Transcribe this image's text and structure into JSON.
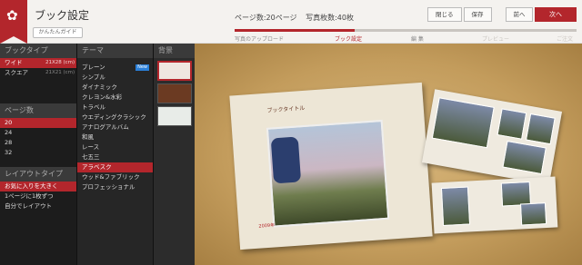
{
  "header": {
    "title": "ブック設定",
    "guide_label": "かんたんガイド",
    "page_count": "ページ数:20ページ",
    "photo_count": "写真枚数:40枚",
    "steps": [
      "写真のアップロード",
      "ブック設定",
      "編 集",
      "プレビュー",
      "ご注文"
    ],
    "close_label": "閉じる",
    "save_label": "保存",
    "prev_label": "前へ",
    "next_label": "次へ"
  },
  "book_type": {
    "heading": "ブックタイプ",
    "items": [
      {
        "label": "ワイド",
        "size": "21X28 (cm)"
      },
      {
        "label": "スクエア",
        "size": "21X21 (cm)"
      }
    ]
  },
  "page_count": {
    "heading": "ページ数",
    "items": [
      "20",
      "24",
      "28",
      "32"
    ]
  },
  "layout_type": {
    "heading": "レイアウトタイプ",
    "items": [
      "お気に入りを大きく",
      "1ページに1枚ずつ",
      "自分でレイアウト"
    ]
  },
  "theme": {
    "heading": "テーマ",
    "new_badge": "New",
    "items": [
      "プレーン",
      "シンプル",
      "ダイナミック",
      "クレヨン&水彩",
      "トラベル",
      "ウエディングクラシック",
      "アナログアルバム",
      "和風",
      "レース",
      "七五三",
      "アラベスク",
      "ウッド&ファブリック",
      "プロフェッショナル"
    ]
  },
  "background": {
    "heading": "背景"
  },
  "preview": {
    "book_title": "ブックタイトル",
    "sub_label": "2009年"
  },
  "colors": {
    "accent": "#b3262c",
    "panel": "#262626"
  }
}
